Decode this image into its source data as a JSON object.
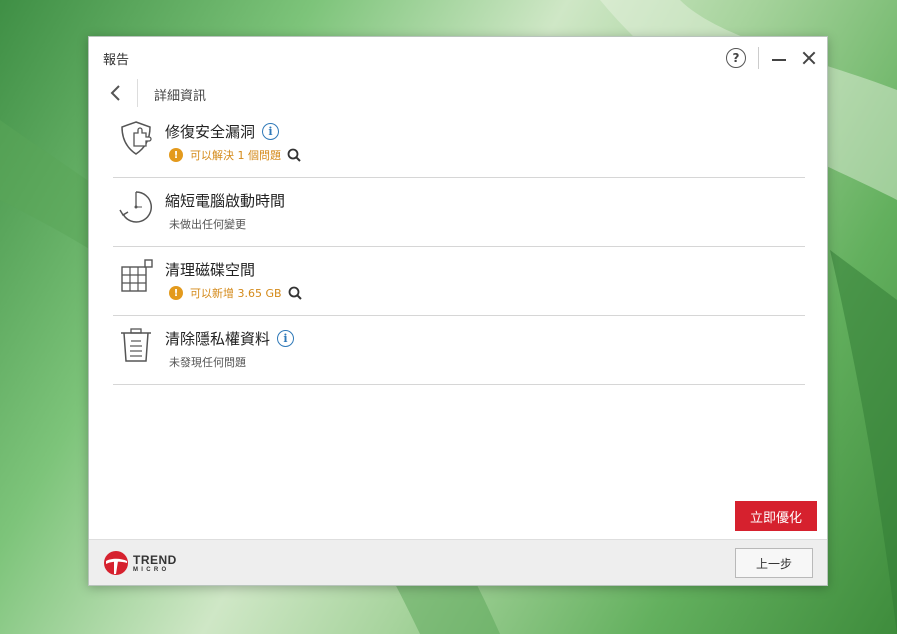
{
  "window": {
    "title": "報告",
    "help_symbol": "?"
  },
  "subheader": {
    "title": "詳細資訊"
  },
  "items": [
    {
      "icon": "shield-puzzle-icon",
      "title": "修復安全漏洞",
      "has_info": true,
      "status_type": "warn",
      "status": "可以解決 1 個問題",
      "has_search": true
    },
    {
      "icon": "timer-icon",
      "title": "縮短電腦啟動時間",
      "has_info": false,
      "status_type": "ok",
      "status": "未做出任何變更",
      "has_search": false
    },
    {
      "icon": "disk-grid-icon",
      "title": "清理磁碟空間",
      "has_info": false,
      "status_type": "warn",
      "status": "可以新增 3.65 GB",
      "has_search": true
    },
    {
      "icon": "trash-icon",
      "title": "清除隱私權資料",
      "has_info": true,
      "status_type": "ok",
      "status": "未發現任何問題",
      "has_search": false
    }
  ],
  "buttons": {
    "optimize_now": "立即優化",
    "previous_step": "上一步"
  },
  "footer": {
    "logo_line1": "TREND",
    "logo_line2": "MICRO"
  },
  "colors": {
    "accent_red": "#d6212e",
    "warn_orange": "#e39a1d",
    "info_blue": "#2f79b8"
  },
  "icons": {
    "warn": "!",
    "info": "i"
  }
}
